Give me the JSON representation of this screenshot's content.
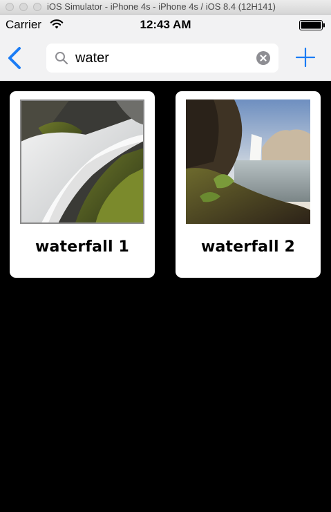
{
  "window": {
    "title": "iOS Simulator - iPhone 4s - iPhone 4s / iOS 8.4 (12H141)"
  },
  "status_bar": {
    "carrier": "Carrier",
    "time": "12:43 AM",
    "wifi_icon": "wifi-icon",
    "battery_icon": "battery-icon"
  },
  "nav_bar": {
    "back_icon": "chevron-left-icon",
    "add_icon": "plus-icon",
    "accent_color": "#1a7cf5"
  },
  "search": {
    "value": "water",
    "search_icon": "magnifier-icon",
    "clear_icon": "clear-icon"
  },
  "results": [
    {
      "title": "waterfall 1",
      "image": "waterfall-photo"
    },
    {
      "title": "waterfall 2",
      "image": "waterfall-landscape-photo"
    }
  ]
}
